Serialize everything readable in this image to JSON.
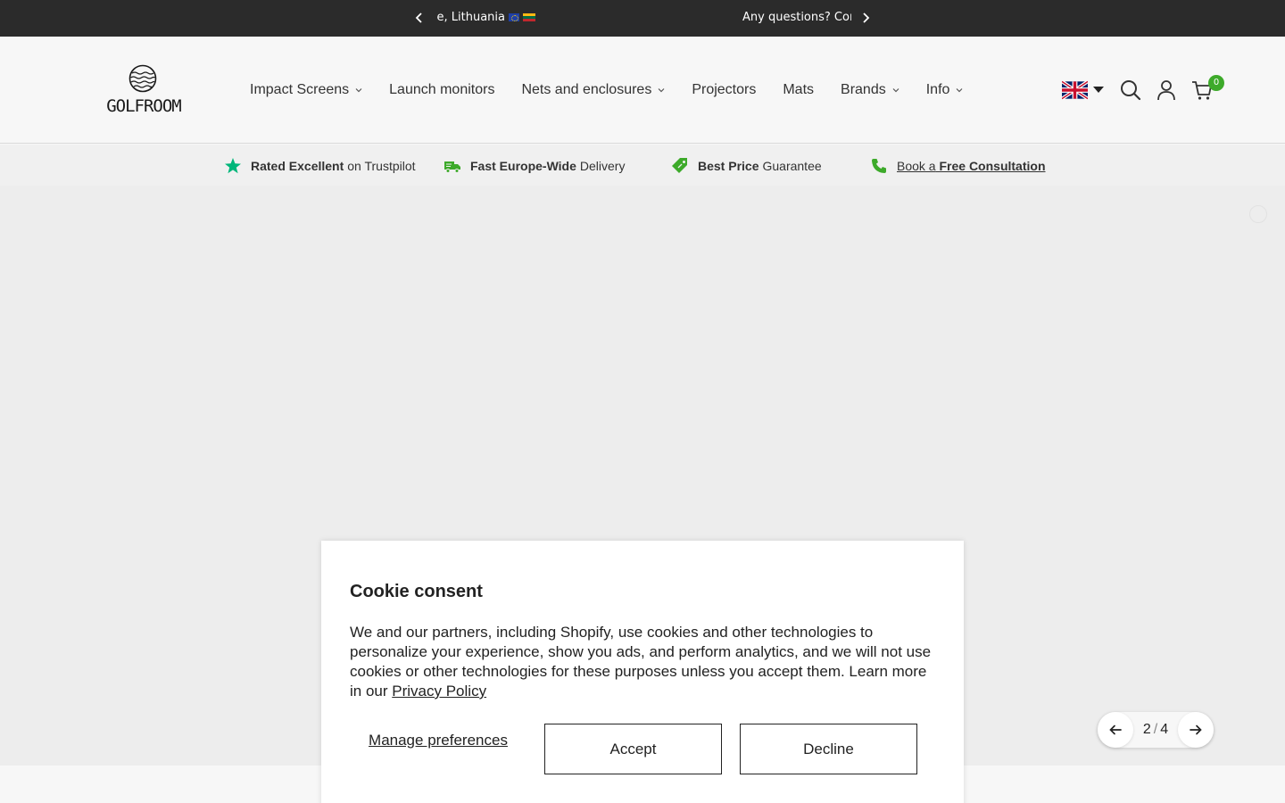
{
  "announcement": {
    "left_text": "Free delivery within Europe, Lithuania",
    "right_text": "Any questions? Contact us"
  },
  "brand": {
    "name": "GOLFROOM"
  },
  "nav": {
    "items": [
      {
        "label": "Impact Screens",
        "has_dropdown": true
      },
      {
        "label": "Launch monitors",
        "has_dropdown": false
      },
      {
        "label": "Nets and enclosures",
        "has_dropdown": true
      },
      {
        "label": "Projectors",
        "has_dropdown": false
      },
      {
        "label": "Mats",
        "has_dropdown": false
      },
      {
        "label": "Brands",
        "has_dropdown": true
      },
      {
        "label": "Info",
        "has_dropdown": true
      }
    ]
  },
  "header_tools": {
    "language_icon": "uk-flag-icon",
    "search_icon": "search-icon",
    "account_icon": "user-icon",
    "cart_icon": "cart-icon",
    "cart_count": "0"
  },
  "usp": {
    "trustpilot": {
      "bold": "Rated Excellent",
      "text": "on Trustpilot"
    },
    "delivery": {
      "bold": "Fast Europe-Wide",
      "text": "Delivery"
    },
    "price": {
      "bold": "Best Price",
      "text": "Guarantee"
    },
    "consult": {
      "text": "Book a",
      "bold": "Free Consultation"
    }
  },
  "slider": {
    "current": "2",
    "separator": "/",
    "total": "4"
  },
  "cookie": {
    "title": "Cookie consent",
    "body": "We and our partners, including Shopify, use cookies and other technologies to personalize your experience, show you ads, and perform analytics, and we will not use cookies or other technologies for these purposes unless you accept them. Learn more in our",
    "privacy_link": "Privacy Policy",
    "manage_label": "Manage preferences",
    "accept_label": "Accept",
    "decline_label": "Decline"
  },
  "colors": {
    "accent_green": "#3daa2a",
    "announcement_bg": "#2b2b2b",
    "trustpilot_green": "#00b67a"
  }
}
